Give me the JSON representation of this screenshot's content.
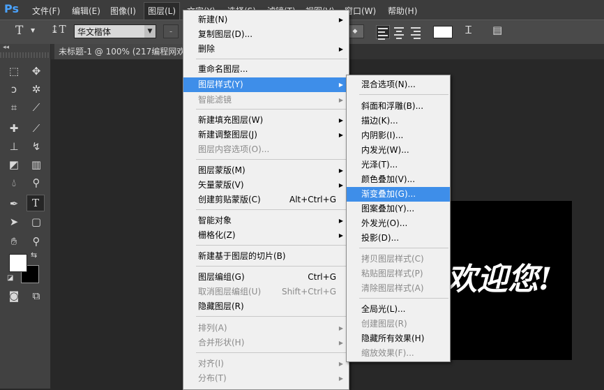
{
  "app": {
    "logo": "Ps"
  },
  "menubar": {
    "items": [
      "文件(F)",
      "编辑(E)",
      "图像(I)",
      "图层(L)",
      "文字(Y)",
      "选择(S)",
      "滤镜(T)",
      "视图(V)",
      "窗口(W)",
      "帮助(H)"
    ]
  },
  "options": {
    "font_family": "华文楷体",
    "small_value": "-"
  },
  "document": {
    "tab_title": "未标题-1 @ 100% (217编程网欢"
  },
  "canvas": {
    "text": "欢迎您!"
  },
  "layer_menu": {
    "items": [
      {
        "label": "新建(N)",
        "submenu": true
      },
      {
        "label": "复制图层(D)..."
      },
      {
        "label": "删除",
        "submenu": true
      },
      {
        "label": "重命名图层..."
      },
      {
        "label": "图层样式(Y)",
        "submenu": true,
        "highlighted": true
      },
      {
        "label": "智能滤镜",
        "submenu": true,
        "disabled": true
      },
      {
        "label": "新建填充图层(W)",
        "submenu": true
      },
      {
        "label": "新建调整图层(J)",
        "submenu": true
      },
      {
        "label": "图层内容选项(O)...",
        "disabled": true
      },
      {
        "label": "图层蒙版(M)",
        "submenu": true
      },
      {
        "label": "矢量蒙版(V)",
        "submenu": true
      },
      {
        "label": "创建剪贴蒙版(C)",
        "shortcut": "Alt+Ctrl+G"
      },
      {
        "label": "智能对象",
        "submenu": true
      },
      {
        "label": "栅格化(Z)",
        "submenu": true
      },
      {
        "label": "新建基于图层的切片(B)"
      },
      {
        "label": "图层编组(G)",
        "shortcut": "Ctrl+G"
      },
      {
        "label": "取消图层编组(U)",
        "shortcut": "Shift+Ctrl+G",
        "disabled": true
      },
      {
        "label": "隐藏图层(R)"
      },
      {
        "label": "排列(A)",
        "submenu": true,
        "disabled": true
      },
      {
        "label": "合并形状(H)",
        "submenu": true,
        "disabled": true
      },
      {
        "label": "对齐(I)",
        "submenu": true,
        "disabled": true
      },
      {
        "label": "分布(T)",
        "submenu": true,
        "disabled": true
      }
    ]
  },
  "style_menu": {
    "items": [
      {
        "label": "混合选项(N)..."
      },
      {
        "label": "斜面和浮雕(B)..."
      },
      {
        "label": "描边(K)..."
      },
      {
        "label": "内阴影(I)..."
      },
      {
        "label": "内发光(W)..."
      },
      {
        "label": "光泽(T)..."
      },
      {
        "label": "颜色叠加(V)..."
      },
      {
        "label": "渐变叠加(G)...",
        "highlighted": true
      },
      {
        "label": "图案叠加(Y)..."
      },
      {
        "label": "外发光(O)..."
      },
      {
        "label": "投影(D)..."
      },
      {
        "label": "拷贝图层样式(C)",
        "disabled": true
      },
      {
        "label": "粘贴图层样式(P)",
        "disabled": true
      },
      {
        "label": "清除图层样式(A)",
        "disabled": true
      },
      {
        "label": "全局光(L)..."
      },
      {
        "label": "创建图层(R)",
        "disabled": true
      },
      {
        "label": "隐藏所有效果(H)"
      },
      {
        "label": "缩放效果(F)...",
        "disabled": true
      }
    ]
  },
  "colors": {
    "highlight": "#3e8ee9",
    "menubar": "#3c3c3c",
    "workspace": "#282828"
  }
}
